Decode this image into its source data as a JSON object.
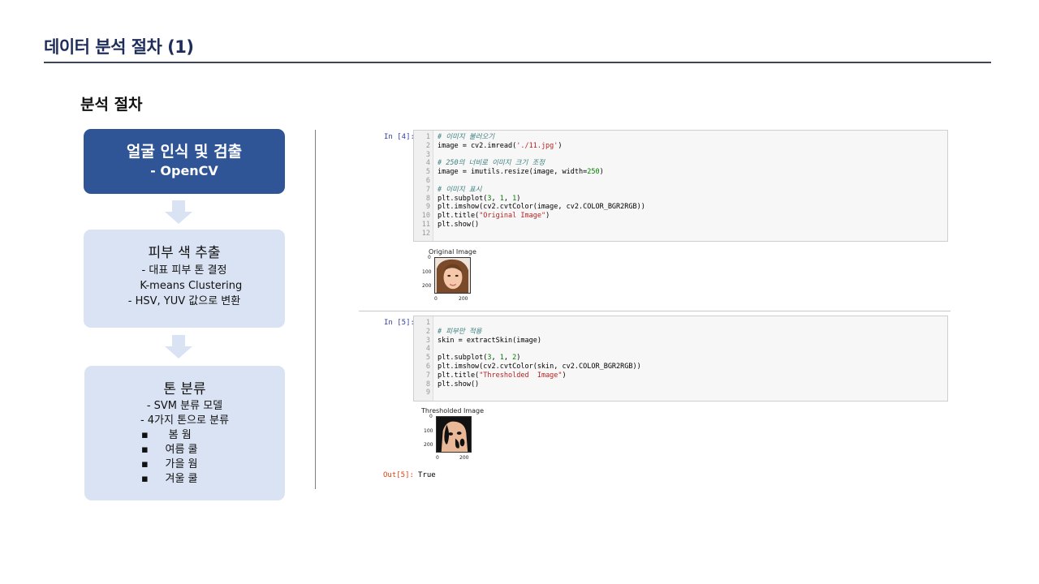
{
  "slide": {
    "title": "데이터 분석 절차 (1)",
    "section_title": "분석 절차"
  },
  "steps": [
    {
      "title": "얼굴 인식 및 검출",
      "subtitle": "- OpenCV"
    },
    {
      "title": "피부 색 추출",
      "details": [
        "- 대표 피부 톤 결정",
        "    K-means Clustering",
        "- HSV, YUV 값으로 변환"
      ]
    },
    {
      "title": "톤 분류",
      "details": [
        "- SVM 분류 모델",
        "- 4가지 톤으로 분류"
      ],
      "bullets": [
        "▪",
        "▪",
        "▪",
        "▪"
      ],
      "bullet_items": [
        "봄 웜",
        "여름 쿨",
        "가을 웜",
        "겨울 쿨"
      ]
    }
  ],
  "notebook": {
    "cells": [
      {
        "prompt": "In [4]:",
        "line_numbers": [
          "1",
          "2",
          "3",
          "4",
          "5",
          "6",
          "7",
          "8",
          "9",
          "10",
          "11",
          "12"
        ],
        "lines": [
          "# 이미지 불러오기",
          "image = cv2.imread('./11.jpg')",
          "",
          "# 250의 너비로 이미지 크기 조정",
          "image = imutils.resize(image, width=250)",
          "",
          "# 이미지 표시",
          "plt.subplot(3, 1, 1)",
          "plt.imshow(cv2.cvtColor(image, cv2.COLOR_BGR2RGB))",
          "plt.title(\"Original Image\")",
          "plt.show()",
          ""
        ],
        "plot": {
          "title": "Original Image",
          "yticks": [
            "0",
            "100",
            "200"
          ],
          "xticks": [
            "0",
            "200"
          ]
        }
      },
      {
        "prompt": "In [5]:",
        "line_numbers": [
          "1",
          "2",
          "3",
          "4",
          "5",
          "6",
          "7",
          "8",
          "9"
        ],
        "lines": [
          "",
          "# 피부만 적용",
          "skin = extractSkin(image)",
          "",
          "plt.subplot(3, 1, 2)",
          "plt.imshow(cv2.cvtColor(skin, cv2.COLOR_BGR2RGB))",
          "plt.title(\"Thresholded  Image\")",
          "plt.show()",
          ""
        ],
        "plot": {
          "title": "Thresholded Image",
          "yticks": [
            "0",
            "100",
            "200"
          ],
          "xticks": [
            "0",
            "200"
          ]
        },
        "out_prompt": "Out[5]:",
        "out_value": "True"
      }
    ]
  },
  "colors": {
    "title": "#1f2d5a",
    "step_dark": "#2f5597",
    "step_light": "#dae3f3",
    "prompt_in": "#303f9f",
    "prompt_out": "#d84315"
  }
}
